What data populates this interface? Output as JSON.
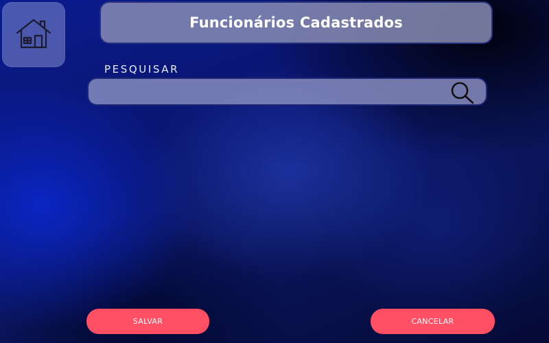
{
  "header": {
    "title": "Funcionários Cadastrados",
    "home_icon": "home-icon"
  },
  "search": {
    "label": "PESQUISAR",
    "value": "",
    "placeholder": "",
    "icon": "search-icon"
  },
  "actions": {
    "save_label": "SALVAR",
    "cancel_label": "CANCELAR"
  },
  "colors": {
    "button_accent": "#ff4f63",
    "background_primary": "#0a1b8f",
    "panel_fill": "#878cb4"
  }
}
